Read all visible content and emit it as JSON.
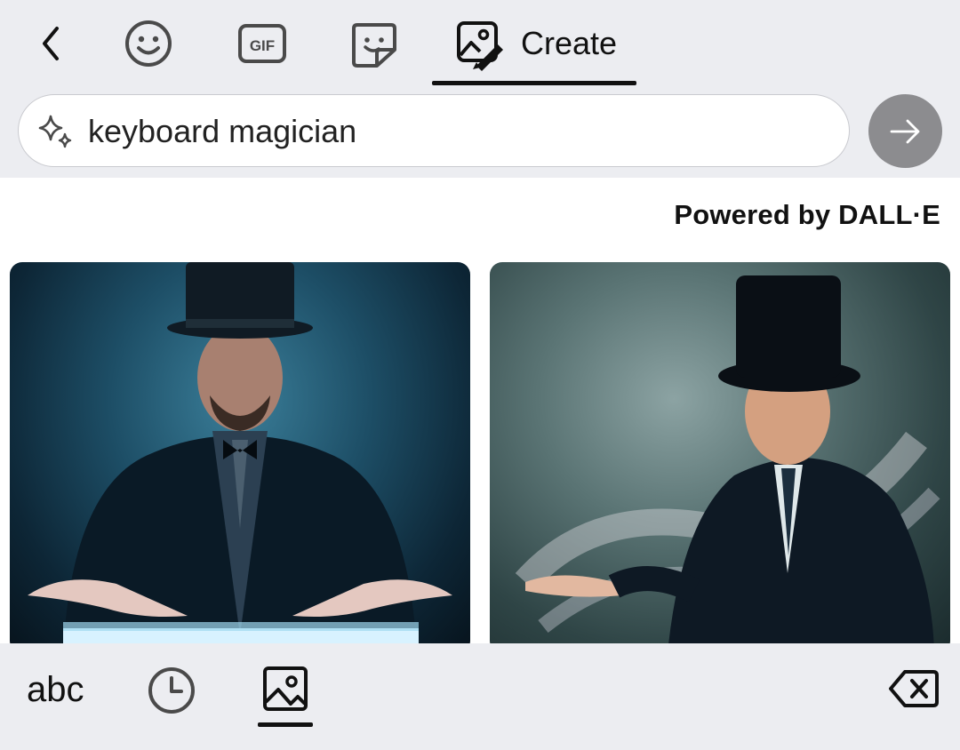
{
  "toolbar": {
    "back_icon": "chevron-left-icon",
    "tabs": [
      {
        "icon": "emoji-icon"
      },
      {
        "icon": "gif-icon",
        "label": "GIF"
      },
      {
        "icon": "sticker-icon"
      },
      {
        "icon": "create-image-icon",
        "label": "Create",
        "active": true
      }
    ]
  },
  "search": {
    "value": "keyboard magician",
    "icon": "sparkle-icon",
    "submit_icon": "arrow-right-icon"
  },
  "results": {
    "powered_by": "Powered by DALL·E",
    "images": [
      {
        "name": "magician-at-keyboard-blue"
      },
      {
        "name": "magician-with-sparkles"
      }
    ]
  },
  "bottom_bar": {
    "abc_label": "abc",
    "recent_icon": "clock-icon",
    "image_icon": "image-icon",
    "delete_icon": "backspace-icon"
  },
  "colors": {
    "background": "#ecedf1",
    "accent": "#111111",
    "submit_button": "#8c8c8f"
  }
}
